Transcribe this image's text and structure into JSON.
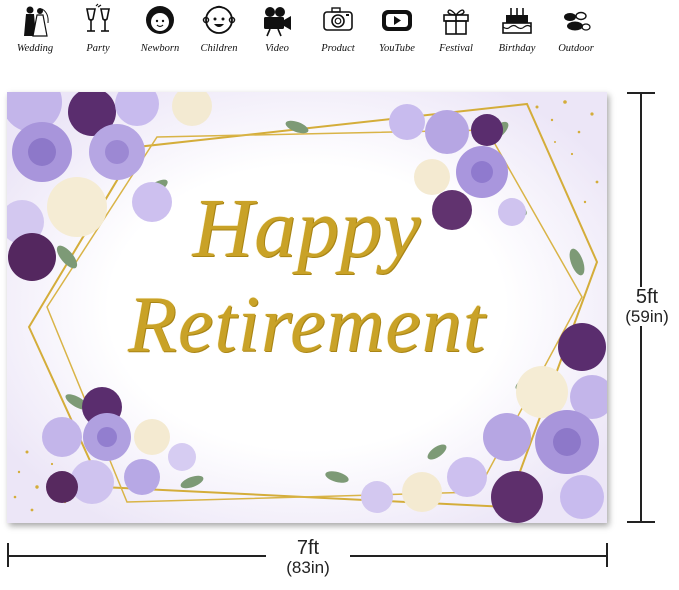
{
  "categories": [
    {
      "label": "Wedding",
      "icon": "bride-groom-icon"
    },
    {
      "label": "Party",
      "icon": "champagne-toast-icon"
    },
    {
      "label": "Newborn",
      "icon": "baby-face-icon"
    },
    {
      "label": "Children",
      "icon": "child-face-icon"
    },
    {
      "label": "Video",
      "icon": "video-camera-icon"
    },
    {
      "label": "Product",
      "icon": "camera-icon"
    },
    {
      "label": "YouTube",
      "icon": "play-button-icon"
    },
    {
      "label": "Festival",
      "icon": "gift-box-icon"
    },
    {
      "label": "Birthday",
      "icon": "birthday-cake-icon"
    },
    {
      "label": "Outdoor",
      "icon": "stones-icon"
    }
  ],
  "banner": {
    "line1": "Happy",
    "line2": "Retirement"
  },
  "dimensions": {
    "height_ft": "5ft",
    "height_in": "(59in)",
    "width_ft": "7ft",
    "width_in": "(83in)"
  },
  "colors": {
    "gold": "#c9a227",
    "lavender": "#b7a6e0",
    "purple": "#5a2d6e",
    "cream": "#f5ecd2",
    "leaf": "#6f8f6a"
  }
}
